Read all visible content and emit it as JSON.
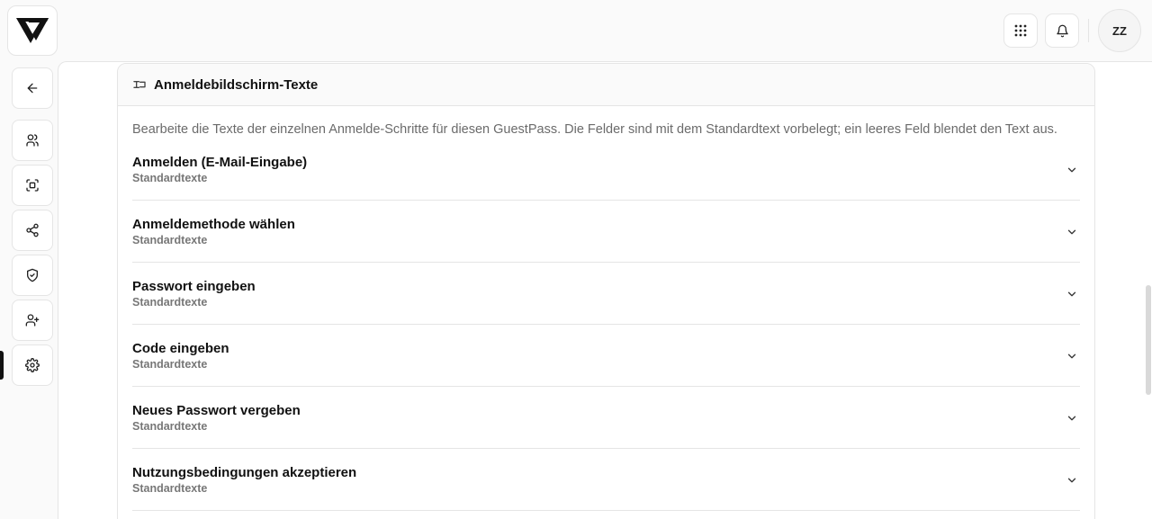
{
  "topbar": {
    "avatar_initials": "ZZ"
  },
  "card": {
    "title": "Anmeldebildschirm-Texte",
    "description": "Bearbeite die Texte der einzelnen Anmelde-Schritte für diesen GuestPass. Die Felder sind mit dem Standardtext vorbelegt; ein leeres Feld blendet den Text aus."
  },
  "sections": [
    {
      "title": "Anmelden (E-Mail-Eingabe)",
      "subtitle": "Standardtexte"
    },
    {
      "title": "Anmeldemethode wählen",
      "subtitle": "Standardtexte"
    },
    {
      "title": "Passwort eingeben",
      "subtitle": "Standardtexte"
    },
    {
      "title": "Code eingeben",
      "subtitle": "Standardtexte"
    },
    {
      "title": "Neues Passwort vergeben",
      "subtitle": "Standardtexte"
    },
    {
      "title": "Nutzungsbedingungen akzeptieren",
      "subtitle": "Standardtexte"
    }
  ],
  "icons": {
    "sidebar": [
      "arrow-left-icon",
      "users-icon",
      "scan-face-icon",
      "share-icon",
      "shield-check-icon",
      "user-plus-icon",
      "gear-icon"
    ],
    "topbar": [
      "grid-icon",
      "bell-icon"
    ]
  }
}
